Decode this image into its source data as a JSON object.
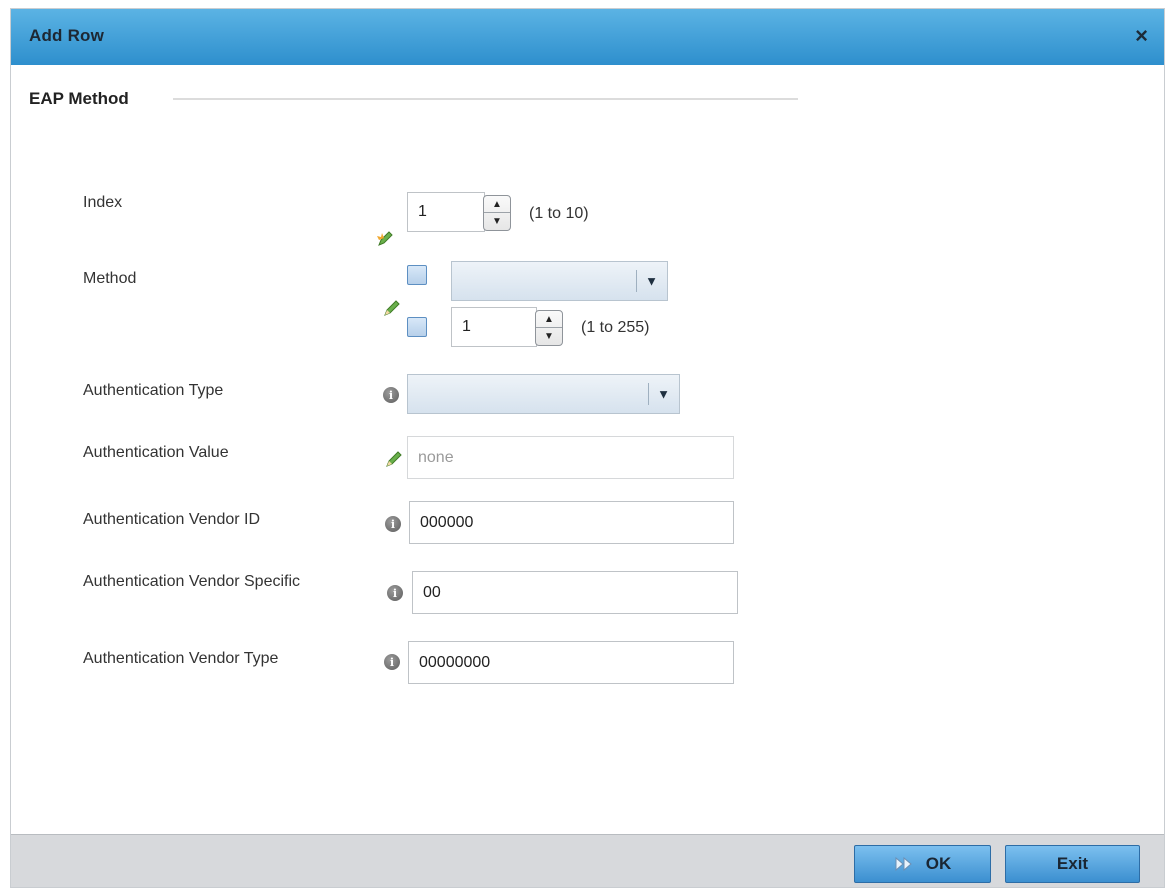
{
  "dialog": {
    "title": "Add Row",
    "close_symbol": "×"
  },
  "section": {
    "title": "EAP Method"
  },
  "fields": {
    "index": {
      "label": "Index",
      "value": "1",
      "range": "(1 to 10)",
      "icon": "required-pencil-icon"
    },
    "method": {
      "label": "Method",
      "select_value": "",
      "number_value": "1",
      "range": "(1 to 255)",
      "icon": "pencil-icon"
    },
    "auth_type": {
      "label": "Authentication Type",
      "select_value": "",
      "icon": "info-icon"
    },
    "auth_value": {
      "label": "Authentication Value",
      "placeholder": "none",
      "icon": "pencil-icon"
    },
    "auth_vendor_id": {
      "label": "Authentication Vendor ID",
      "value": "000000",
      "icon": "info-icon"
    },
    "auth_vendor_specific": {
      "label": "Authentication Vendor Specific",
      "value": "00",
      "icon": "info-icon"
    },
    "auth_vendor_type": {
      "label": "Authentication Vendor Type",
      "value": "00000000",
      "icon": "info-icon"
    }
  },
  "footer": {
    "ok_label": "OK",
    "exit_label": "Exit"
  },
  "colors": {
    "titlebar": "#3f9fd8",
    "button": "#5aa8e2",
    "footer": "#d7d9dc"
  }
}
